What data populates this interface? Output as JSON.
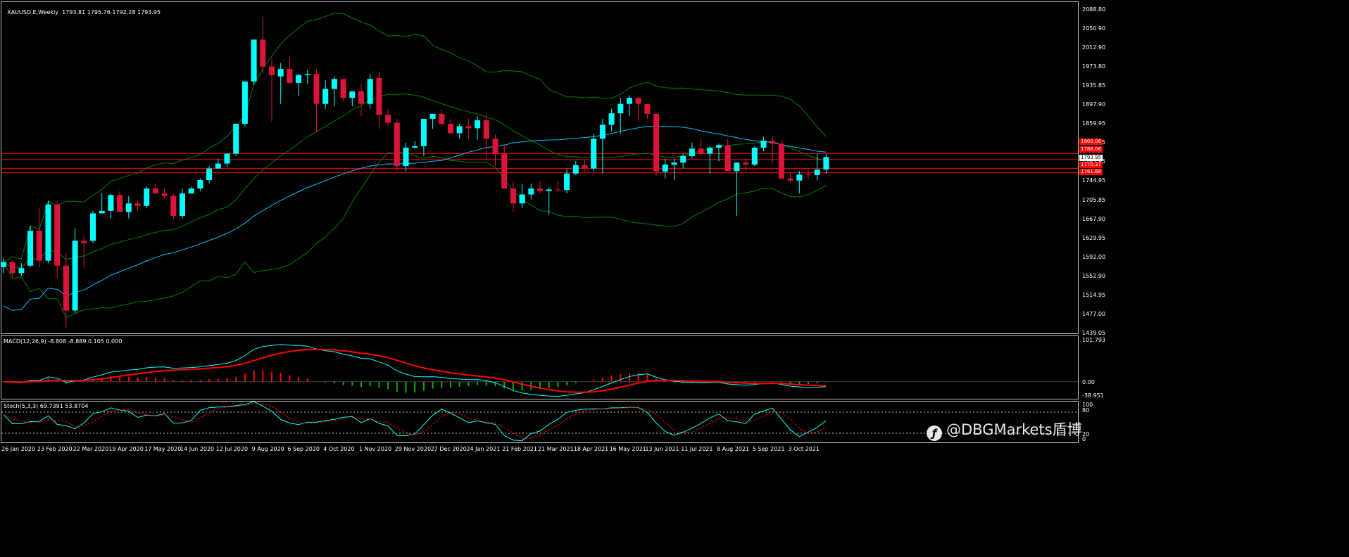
{
  "header": {
    "symbol": "XAUUSD.E,Weekly",
    "ohlc": "1793.81 1795.76 1792.28 1793.95"
  },
  "macd": {
    "label": "MACD(12,26,9) -8.808 -8.889 0.105 0.000",
    "ticks": [
      "101.793",
      "0.00",
      "-38.951"
    ]
  },
  "stoch": {
    "label": "Stoch(5,3,3) 69.7391 53.8704",
    "ticks": [
      "100",
      "80",
      "20",
      "0"
    ]
  },
  "price_labels": {
    "current": "1793.95",
    "l1": "1800.06",
    "l2": "1788.06",
    "l3": "1770.37",
    "l4": "1761.68"
  },
  "watermark": "@DBGMarkets盾博",
  "colors": {
    "bull": "#00ffff",
    "bear": "#dc143c",
    "bollinger": "#008000",
    "ma": "#00bfff",
    "hlines": "#ff0000",
    "macd_main": "#00ffff",
    "macd_signal": "#ff0000",
    "stoch_main": "#00ffff",
    "stoch_signal": "#ff0000"
  },
  "chart_data": {
    "type": "candlestick",
    "symbol": "XAUUSD.E",
    "timeframe": "Weekly",
    "y_ticks": [
      "2088.80",
      "2050.90",
      "2012.90",
      "1973.80",
      "1935.85",
      "1897.90",
      "1859.95",
      "1821.95",
      "1783.95",
      "1744.95",
      "1705.85",
      "1667.90",
      "1629.95",
      "1592.00",
      "1552.90",
      "1514.95",
      "1477.00",
      "1439.05"
    ],
    "ylim": [
      1439.05,
      2088.8
    ],
    "x_labels": [
      "26 Jan 2020",
      "23 Feb 2020",
      "22 Mar 2020",
      "19 Apr 2020",
      "17 May 2020",
      "14 Jun 2020",
      "12 Jul 2020",
      "9 Aug 2020",
      "6 Sep 2020",
      "4 Oct 2020",
      "1 Nov 2020",
      "29 Nov 2020",
      "27 Dec 2020",
      "24 Jan 2021",
      "21 Feb 2021",
      "21 Mar 2021",
      "18 Apr 2021",
      "16 May 2021",
      "13 Jun 2021",
      "11 Jul 2021",
      "8 Aug 2021",
      "5 Sep 2021",
      "3 Oct 2021"
    ],
    "horizontal_levels": [
      1800.06,
      1788.06,
      1770.37,
      1761.68
    ],
    "candles": [
      [
        1572,
        1590,
        1560,
        1582
      ],
      [
        1582,
        1586,
        1552,
        1560
      ],
      [
        1560,
        1580,
        1555,
        1570
      ],
      [
        1575,
        1655,
        1572,
        1645
      ],
      [
        1645,
        1690,
        1571,
        1585
      ],
      [
        1585,
        1705,
        1580,
        1698
      ],
      [
        1698,
        1703,
        1550,
        1575
      ],
      [
        1575,
        1600,
        1451,
        1485
      ],
      [
        1485,
        1650,
        1480,
        1625
      ],
      [
        1625,
        1635,
        1570,
        1620
      ],
      [
        1625,
        1685,
        1620,
        1680
      ],
      [
        1680,
        1720,
        1680,
        1685
      ],
      [
        1685,
        1720,
        1670,
        1717
      ],
      [
        1717,
        1725,
        1685,
        1683
      ],
      [
        1683,
        1715,
        1670,
        1700
      ],
      [
        1700,
        1705,
        1685,
        1695
      ],
      [
        1695,
        1735,
        1690,
        1730
      ],
      [
        1730,
        1740,
        1720,
        1720
      ],
      [
        1720,
        1730,
        1710,
        1715
      ],
      [
        1715,
        1720,
        1667,
        1675
      ],
      [
        1675,
        1730,
        1670,
        1720
      ],
      [
        1720,
        1733,
        1720,
        1730
      ],
      [
        1730,
        1750,
        1725,
        1747
      ],
      [
        1747,
        1775,
        1740,
        1770
      ],
      [
        1770,
        1790,
        1770,
        1780
      ],
      [
        1780,
        1800,
        1773,
        1800
      ],
      [
        1800,
        1855,
        1795,
        1860
      ],
      [
        1860,
        1942,
        1855,
        1945
      ],
      [
        1945,
        1980,
        1938,
        2029
      ],
      [
        2029,
        2075,
        1960,
        1975
      ],
      [
        1975,
        1992,
        1865,
        1958
      ],
      [
        1955,
        1982,
        1900,
        1970
      ],
      [
        1970,
        1995,
        1940,
        1942
      ],
      [
        1942,
        1960,
        1915,
        1958
      ],
      [
        1958,
        1968,
        1940,
        1960
      ],
      [
        1960,
        1970,
        1843,
        1900
      ],
      [
        1900,
        1947,
        1890,
        1930
      ],
      [
        1930,
        1955,
        1895,
        1950
      ],
      [
        1950,
        1935,
        1905,
        1912
      ],
      [
        1912,
        1922,
        1895,
        1925
      ],
      [
        1925,
        1940,
        1875,
        1900
      ],
      [
        1900,
        1960,
        1890,
        1950
      ],
      [
        1952,
        1965,
        1850,
        1878
      ],
      [
        1878,
        1890,
        1855,
        1862
      ],
      [
        1862,
        1870,
        1765,
        1775
      ],
      [
        1775,
        1822,
        1765,
        1812
      ],
      [
        1812,
        1825,
        1810,
        1815
      ],
      [
        1815,
        1860,
        1795,
        1870
      ],
      [
        1870,
        1875,
        1850,
        1880
      ],
      [
        1880,
        1888,
        1855,
        1860
      ],
      [
        1860,
        1870,
        1840,
        1841
      ],
      [
        1841,
        1860,
        1830,
        1855
      ],
      [
        1855,
        1870,
        1830,
        1851
      ],
      [
        1851,
        1875,
        1828,
        1867
      ],
      [
        1867,
        1880,
        1786,
        1830
      ],
      [
        1830,
        1838,
        1775,
        1800
      ],
      [
        1800,
        1820,
        1765,
        1730
      ],
      [
        1730,
        1745,
        1683,
        1700
      ],
      [
        1700,
        1740,
        1690,
        1718
      ],
      [
        1718,
        1740,
        1708,
        1730
      ],
      [
        1730,
        1745,
        1720,
        1725
      ],
      [
        1725,
        1732,
        1677,
        1728
      ],
      [
        1728,
        1745,
        1722,
        1727
      ],
      [
        1727,
        1770,
        1720,
        1760
      ],
      [
        1760,
        1785,
        1757,
        1777
      ],
      [
        1777,
        1788,
        1765,
        1770
      ],
      [
        1770,
        1840,
        1765,
        1830
      ],
      [
        1830,
        1870,
        1760,
        1858
      ],
      [
        1858,
        1890,
        1845,
        1881
      ],
      [
        1881,
        1912,
        1840,
        1900
      ],
      [
        1900,
        1917,
        1875,
        1912
      ],
      [
        1912,
        1915,
        1865,
        1900
      ],
      [
        1900,
        1897,
        1870,
        1880
      ],
      [
        1880,
        1877,
        1755,
        1764
      ],
      [
        1764,
        1790,
        1750,
        1778
      ],
      [
        1778,
        1790,
        1747,
        1782
      ],
      [
        1782,
        1800,
        1770,
        1795
      ],
      [
        1795,
        1822,
        1790,
        1810
      ],
      [
        1810,
        1830,
        1795,
        1800
      ],
      [
        1800,
        1815,
        1760,
        1812
      ],
      [
        1812,
        1820,
        1785,
        1817
      ],
      [
        1817,
        1830,
        1780,
        1765
      ],
      [
        1765,
        1780,
        1675,
        1782
      ],
      [
        1782,
        1790,
        1765,
        1778
      ],
      [
        1778,
        1815,
        1775,
        1812
      ],
      [
        1812,
        1834,
        1805,
        1826
      ],
      [
        1826,
        1835,
        1780,
        1820
      ],
      [
        1820,
        1828,
        1755,
        1750
      ],
      [
        1750,
        1762,
        1742,
        1746
      ],
      [
        1746,
        1765,
        1720,
        1758
      ],
      [
        1758,
        1770,
        1748,
        1757
      ],
      [
        1757,
        1800,
        1746,
        1768
      ],
      [
        1768,
        1799,
        1760,
        1793
      ]
    ],
    "series": [
      {
        "name": "MACD(12,26,9)",
        "main": -8.808,
        "signal": -8.889
      },
      {
        "name": "Stoch(5,3,3)",
        "main": 69.7391,
        "signal": 53.8704
      }
    ]
  },
  "x_axis": [
    "26 Jan 2020",
    "23 Feb 2020",
    "22 Mar 2020",
    "19 Apr 2020",
    "17 May 2020",
    "14 Jun 2020",
    "12 Jul 2020",
    "9 Aug 2020",
    "6 Sep 2020",
    "4 Oct 2020",
    "1 Nov 2020",
    "29 Nov 2020",
    "27 Dec 2020",
    "24 Jan 2021",
    "21 Feb 2021",
    "21 Mar 2021",
    "18 Apr 2021",
    "16 May 2021",
    "13 Jun 2021",
    "11 Jul 2021",
    "8 Aug 2021",
    "5 Sep 2021",
    "3 Oct 2021"
  ]
}
